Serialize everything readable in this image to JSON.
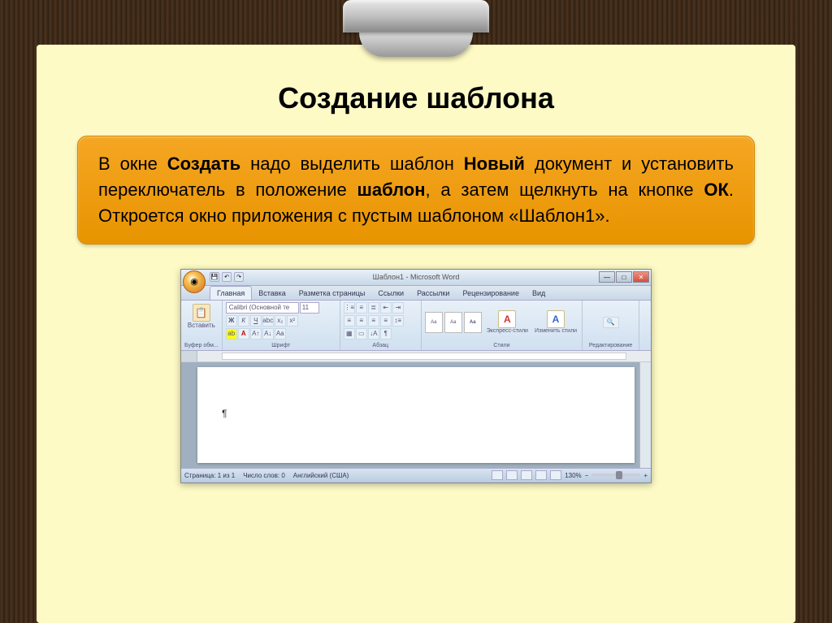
{
  "slide": {
    "title": "Создание шаблона",
    "body_parts": {
      "p1": "В окне ",
      "b1": "Создать",
      "p2": " надо выделить шаблон ",
      "b2": "Новый",
      "p3": " документ и установить переключатель в положение ",
      "b3": "шаблон",
      "p4": ", а затем щелкнуть на кнопке ",
      "b4": "ОК",
      "p5": ". Откроется окно приложения с пустым шаблоном «Шаблон1»."
    }
  },
  "word": {
    "title": "Шаблон1 - Microsoft Word",
    "tabs": [
      "Главная",
      "Вставка",
      "Разметка страницы",
      "Ссылки",
      "Рассылки",
      "Рецензирование",
      "Вид"
    ],
    "clipboard": {
      "paste": "Вставить",
      "group": "Буфер обм..."
    },
    "font": {
      "name": "Calibri (Основной те",
      "size": "11",
      "group": "Шрифт"
    },
    "paragraph": {
      "group": "Абзац"
    },
    "styles": {
      "quick": "Экспресс-стили",
      "change": "Изменить стили",
      "group": "Стили"
    },
    "editing": {
      "group": "Редактирование"
    },
    "doc": {
      "paragraph_mark": "¶"
    },
    "status": {
      "page": "Страница: 1 из 1",
      "words": "Число слов: 0",
      "lang": "Английский (США)",
      "zoom": "130%"
    }
  }
}
